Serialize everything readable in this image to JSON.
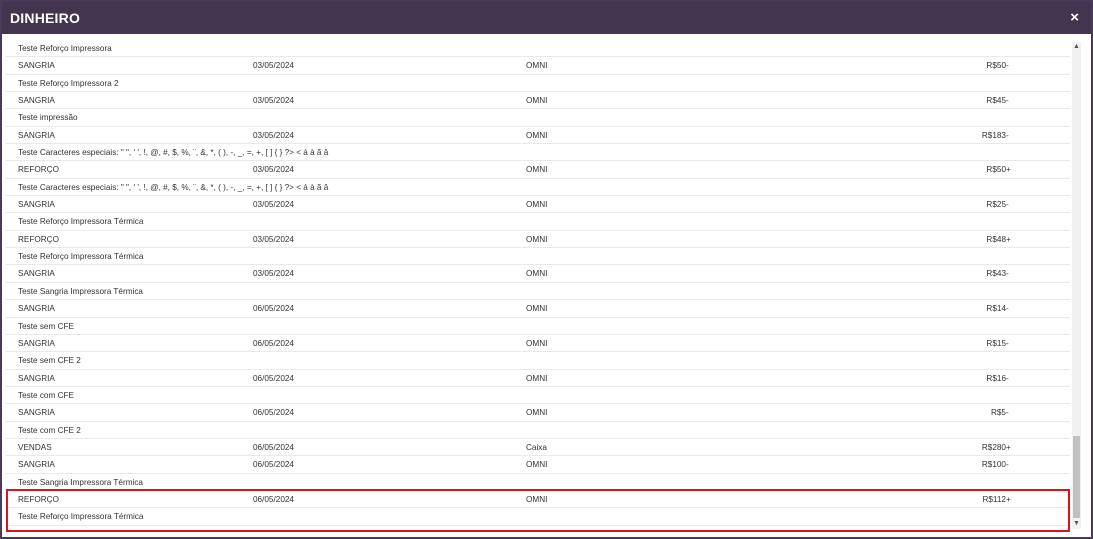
{
  "window": {
    "title": "DINHEIRO",
    "close_label": "×"
  },
  "rows": [
    {
      "type": "desc",
      "text": "Teste Reforço Impressora"
    },
    {
      "type": "entry",
      "kind": "SANGRIA",
      "date": "03/05/2024",
      "source": "OMNI",
      "value": "R$50",
      "sign": "-"
    },
    {
      "type": "desc",
      "text": "Teste Reforço Impressora 2"
    },
    {
      "type": "entry",
      "kind": "SANGRIA",
      "date": "03/05/2024",
      "source": "OMNI",
      "value": "R$45",
      "sign": "-"
    },
    {
      "type": "desc",
      "text": "Teste impressão"
    },
    {
      "type": "entry",
      "kind": "SANGRIA",
      "date": "03/05/2024",
      "source": "OMNI",
      "value": "R$183",
      "sign": "-"
    },
    {
      "type": "desc",
      "text": "Teste Caracteres especiais: \" \", ' ', !, @, #, $, %, ¨, &, *, ( ), -, _, =, +, [ ] { } ?> < á à ã â"
    },
    {
      "type": "entry",
      "kind": "REFORÇO",
      "date": "03/05/2024",
      "source": "OMNI",
      "value": "R$50",
      "sign": "+"
    },
    {
      "type": "desc",
      "text": "Teste Caracteres especiais: \" \", ' ', !, @, #, $, %, ¨, &, *, ( ), -, _, =, +, [ ] { } ?> < á à ã â"
    },
    {
      "type": "entry",
      "kind": "SANGRIA",
      "date": "03/05/2024",
      "source": "OMNI",
      "value": "R$25",
      "sign": "-"
    },
    {
      "type": "desc",
      "text": "Teste Reforço Impressora Térmica"
    },
    {
      "type": "entry",
      "kind": "REFORÇO",
      "date": "03/05/2024",
      "source": "OMNI",
      "value": "R$48",
      "sign": "+"
    },
    {
      "type": "desc",
      "text": "Teste Reforço Impressora Térmica"
    },
    {
      "type": "entry",
      "kind": "SANGRIA",
      "date": "03/05/2024",
      "source": "OMNI",
      "value": "R$43",
      "sign": "-"
    },
    {
      "type": "desc",
      "text": "Teste Sangria Impressora Térmica"
    },
    {
      "type": "entry",
      "kind": "SANGRIA",
      "date": "06/05/2024",
      "source": "OMNI",
      "value": "R$14",
      "sign": "-"
    },
    {
      "type": "desc",
      "text": "Teste sem CFE"
    },
    {
      "type": "entry",
      "kind": "SANGRIA",
      "date": "06/05/2024",
      "source": "OMNI",
      "value": "R$15",
      "sign": "-"
    },
    {
      "type": "desc",
      "text": "Teste sem CFE 2"
    },
    {
      "type": "entry",
      "kind": "SANGRIA",
      "date": "06/05/2024",
      "source": "OMNI",
      "value": "R$16",
      "sign": "-"
    },
    {
      "type": "desc",
      "text": "Teste com CFE"
    },
    {
      "type": "entry",
      "kind": "SANGRIA",
      "date": "06/05/2024",
      "source": "OMNI",
      "value": "R$5",
      "sign": "-"
    },
    {
      "type": "desc",
      "text": "Teste com CFE 2"
    },
    {
      "type": "entry",
      "kind": "VENDAS",
      "date": "06/05/2024",
      "source": "Caixa",
      "value": "R$280",
      "sign": "+"
    },
    {
      "type": "entry",
      "kind": "SANGRIA",
      "date": "06/05/2024",
      "source": "OMNI",
      "value": "R$100",
      "sign": "-"
    },
    {
      "type": "desc",
      "text": "Teste Sangria Impressora Térmica"
    },
    {
      "type": "entry",
      "kind": "REFORÇO",
      "date": "06/05/2024",
      "source": "OMNI",
      "value": "R$112",
      "sign": "+"
    },
    {
      "type": "desc",
      "text": "Teste Reforço Impressora Térmica"
    }
  ],
  "colors": {
    "titlebar": "#43344f",
    "highlight": "#d9141b"
  }
}
